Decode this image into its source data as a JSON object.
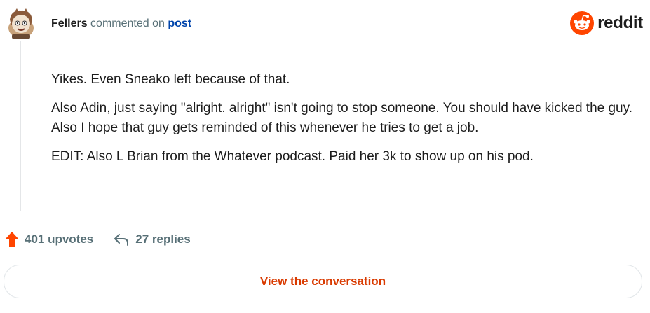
{
  "header": {
    "author": "Fellers",
    "action": "commented on",
    "target": "post"
  },
  "brand": {
    "wordmark": "reddit",
    "icon": "reddit-logo-icon",
    "color": "#ff4500"
  },
  "comment": {
    "paragraphs": [
      "Yikes. Even Sneako left because of that.",
      "Also Adin, just saying \"alright. alright\" isn't going to stop someone. You should have kicked the guy. Also I hope that guy gets reminded of this whenever he tries to get a job.",
      "EDIT: Also L Brian from the Whatever podcast. Paid her 3k to show up on his pod."
    ]
  },
  "actions": {
    "upvotes": "401 upvotes",
    "upvote_icon": "upvote-arrow-icon",
    "upvote_color": "#ff4500",
    "replies": "27 replies",
    "reply_icon": "reply-arrow-icon"
  },
  "cta": {
    "label": "View the conversation",
    "color": "#d93a00"
  }
}
